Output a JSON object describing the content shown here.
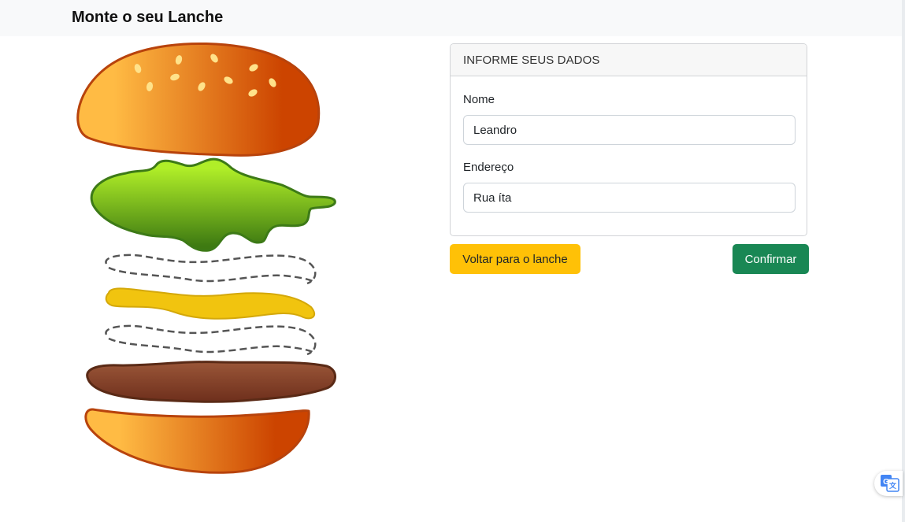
{
  "navbar": {
    "brand": "Monte o seu Lanche"
  },
  "burger": {
    "layers": [
      "top-bun",
      "lettuce",
      "onion",
      "mustard",
      "onion",
      "patty",
      "bottom-bun"
    ]
  },
  "form": {
    "header": "INFORME SEUS DADOS",
    "nome_label": "Nome",
    "nome_value": "Leandro",
    "endereco_label": "Endereço",
    "endereco_value": "Rua íta"
  },
  "actions": {
    "back_label": "Voltar para o lanche",
    "confirm_label": "Confirmar"
  },
  "colors": {
    "warning": "#ffc107",
    "success": "#198754",
    "bun_light": "#ffbb44",
    "bun_dark": "#cc4400",
    "lettuce": "#a6e22e",
    "patty": "#8b4513",
    "mustard": "#f1c40f"
  },
  "icons": {
    "translate": "google-translate-icon"
  }
}
